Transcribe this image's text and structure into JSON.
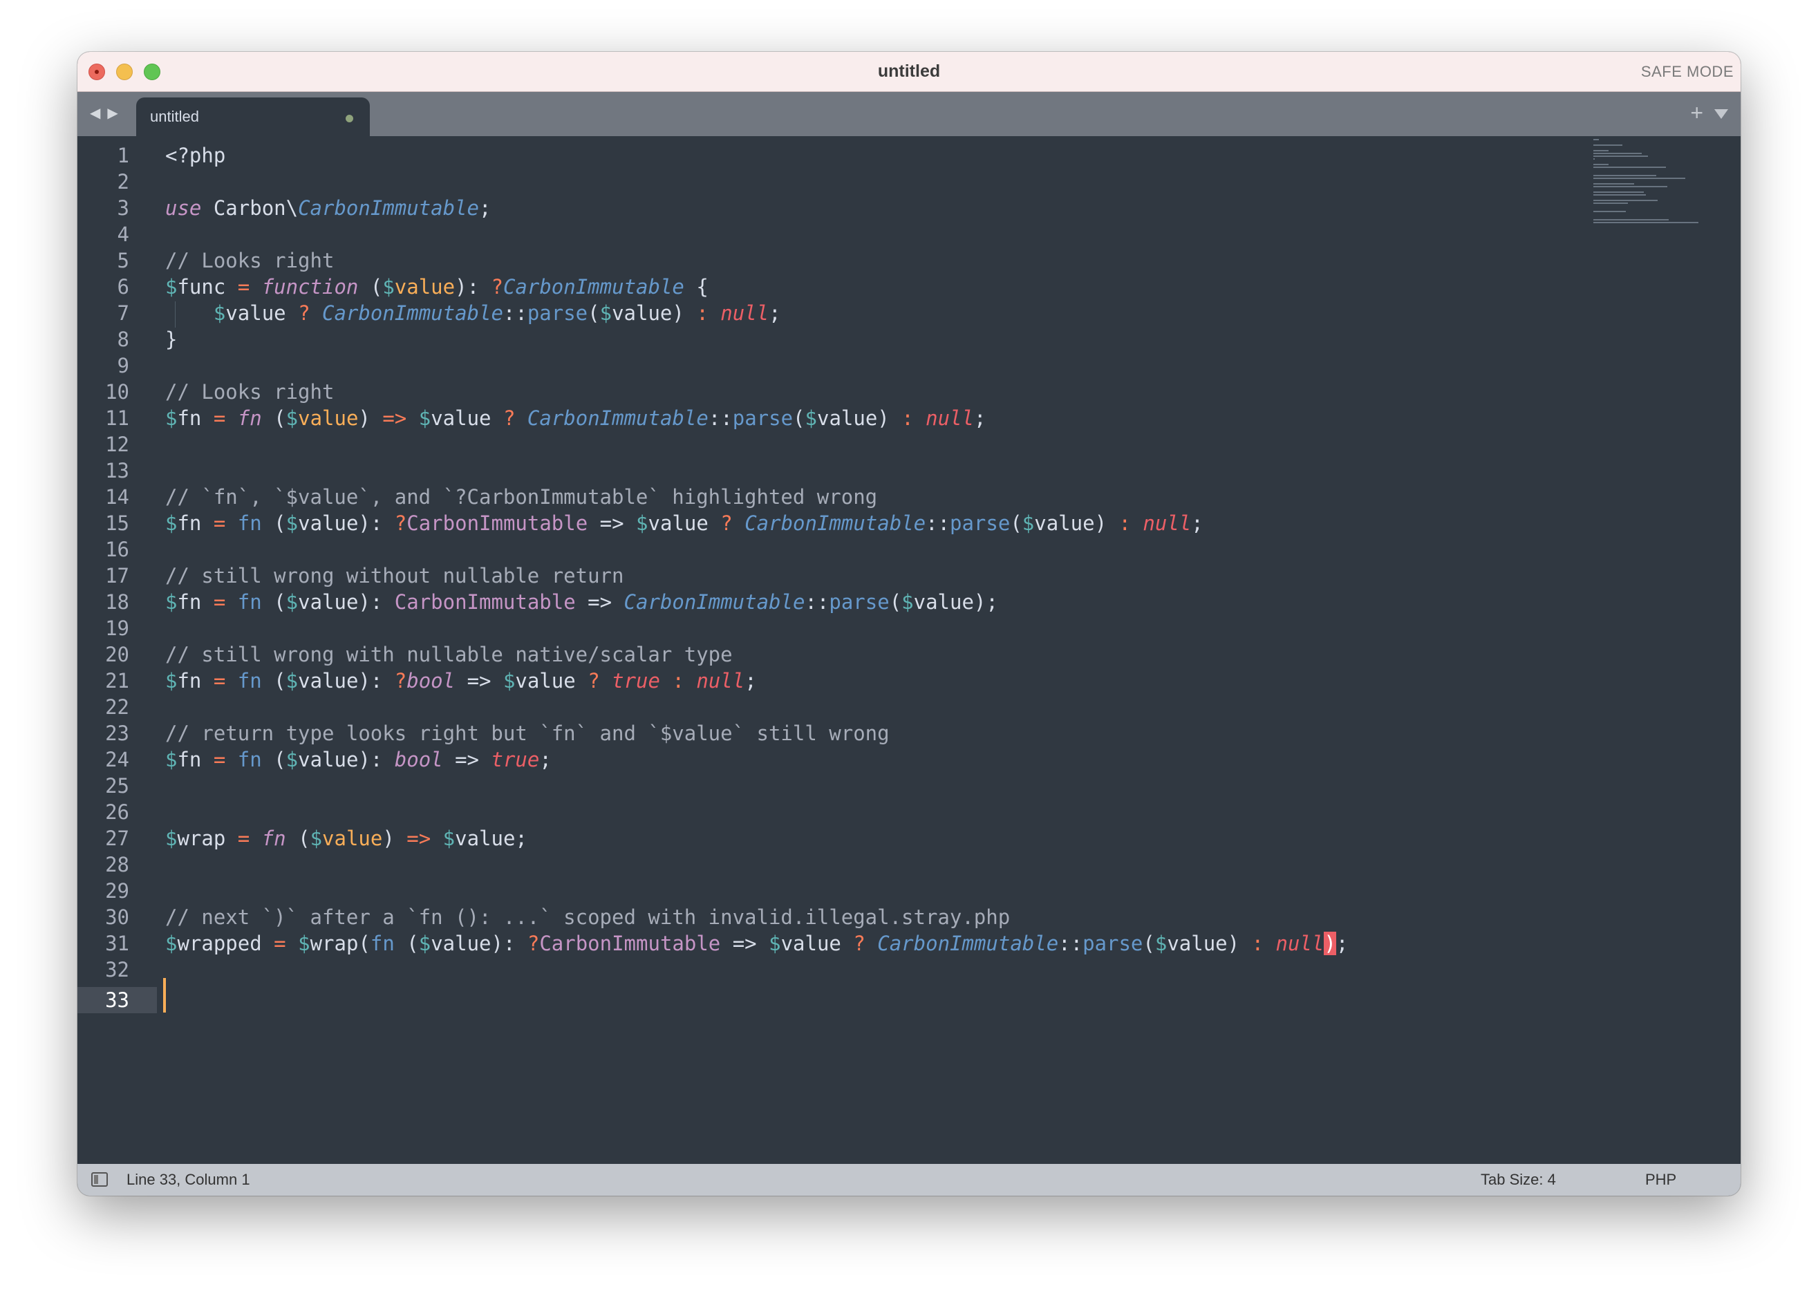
{
  "window": {
    "title": "untitled",
    "mode_label": "SAFE MODE"
  },
  "tabs": {
    "active_label": "untitled"
  },
  "editor": {
    "lines": [
      "1",
      "2",
      "3",
      "4",
      "5",
      "6",
      "7",
      "8",
      "9",
      "10",
      "11",
      "12",
      "13",
      "14",
      "15",
      "16",
      "17",
      "18",
      "19",
      "20",
      "21",
      "22",
      "23",
      "24",
      "25",
      "26",
      "27",
      "28",
      "29",
      "30",
      "31",
      "32",
      "33"
    ],
    "current_line": 33,
    "code": [
      [
        [
          "pp",
          "<?php"
        ]
      ],
      [],
      [
        [
          "kw",
          "use"
        ],
        [
          "pl",
          " Carbon\\"
        ],
        [
          "cl",
          "CarbonImmutable"
        ],
        [
          "pl",
          ";"
        ]
      ],
      [],
      [
        [
          "cm",
          "// Looks right"
        ]
      ],
      [
        [
          "vr",
          "$"
        ],
        [
          "pl",
          "func "
        ],
        [
          "op",
          "="
        ],
        [
          "pl",
          " "
        ],
        [
          "kw",
          "function"
        ],
        [
          "pl",
          " ("
        ],
        [
          "vr",
          "$"
        ],
        [
          "pa",
          "value"
        ],
        [
          "pl",
          "): "
        ],
        [
          "op",
          "?"
        ],
        [
          "cl",
          "CarbonImmutable"
        ],
        [
          "pl",
          " {"
        ]
      ],
      [
        [
          "pl",
          "    "
        ],
        [
          "vr",
          "$"
        ],
        [
          "pl",
          "value "
        ],
        [
          "op",
          "?"
        ],
        [
          "pl",
          " "
        ],
        [
          "cl",
          "CarbonImmutable"
        ],
        [
          "pl",
          "::"
        ],
        [
          "fn",
          "parse"
        ],
        [
          "pl",
          "("
        ],
        [
          "vr",
          "$"
        ],
        [
          "pl",
          "value) "
        ],
        [
          "op",
          ":"
        ],
        [
          "pl",
          " "
        ],
        [
          "cn",
          "null"
        ],
        [
          "pl",
          ";"
        ]
      ],
      [
        [
          "pl",
          "}"
        ]
      ],
      [],
      [
        [
          "cm",
          "// Looks right"
        ]
      ],
      [
        [
          "vr",
          "$"
        ],
        [
          "pl",
          "fn "
        ],
        [
          "op",
          "="
        ],
        [
          "pl",
          " "
        ],
        [
          "kw",
          "fn"
        ],
        [
          "pl",
          " ("
        ],
        [
          "vr",
          "$"
        ],
        [
          "pa",
          "value"
        ],
        [
          "pl",
          ") "
        ],
        [
          "op",
          "=>"
        ],
        [
          "pl",
          " "
        ],
        [
          "vr",
          "$"
        ],
        [
          "pl",
          "value "
        ],
        [
          "op",
          "?"
        ],
        [
          "pl",
          " "
        ],
        [
          "cl",
          "CarbonImmutable"
        ],
        [
          "pl",
          "::"
        ],
        [
          "fn",
          "parse"
        ],
        [
          "pl",
          "("
        ],
        [
          "vr",
          "$"
        ],
        [
          "pl",
          "value) "
        ],
        [
          "op",
          ":"
        ],
        [
          "pl",
          " "
        ],
        [
          "cn",
          "null"
        ],
        [
          "pl",
          ";"
        ]
      ],
      [],
      [],
      [
        [
          "cm",
          "// `fn`, `$value`, and `?CarbonImmutable` highlighted wrong"
        ]
      ],
      [
        [
          "vr",
          "$"
        ],
        [
          "pl",
          "fn "
        ],
        [
          "op",
          "="
        ],
        [
          "pl",
          " "
        ],
        [
          "fn",
          "fn"
        ],
        [
          "pl",
          " ("
        ],
        [
          "vr",
          "$"
        ],
        [
          "pl",
          "value): "
        ],
        [
          "op",
          "?"
        ],
        [
          "cb",
          "CarbonImmutable"
        ],
        [
          "pl",
          " => "
        ],
        [
          "vr",
          "$"
        ],
        [
          "pl",
          "value "
        ],
        [
          "op",
          "?"
        ],
        [
          "pl",
          " "
        ],
        [
          "cl",
          "CarbonImmutable"
        ],
        [
          "pl",
          "::"
        ],
        [
          "fn",
          "parse"
        ],
        [
          "pl",
          "("
        ],
        [
          "vr",
          "$"
        ],
        [
          "pl",
          "value) "
        ],
        [
          "op",
          ":"
        ],
        [
          "pl",
          " "
        ],
        [
          "cn",
          "null"
        ],
        [
          "pl",
          ";"
        ]
      ],
      [],
      [
        [
          "cm",
          "// still wrong without nullable return"
        ]
      ],
      [
        [
          "vr",
          "$"
        ],
        [
          "pl",
          "fn "
        ],
        [
          "op",
          "="
        ],
        [
          "pl",
          " "
        ],
        [
          "fn",
          "fn"
        ],
        [
          "pl",
          " ("
        ],
        [
          "vr",
          "$"
        ],
        [
          "pl",
          "value): "
        ],
        [
          "cb",
          "CarbonImmutable"
        ],
        [
          "pl",
          " => "
        ],
        [
          "cl",
          "CarbonImmutable"
        ],
        [
          "pl",
          "::"
        ],
        [
          "fn",
          "parse"
        ],
        [
          "pl",
          "("
        ],
        [
          "vr",
          "$"
        ],
        [
          "pl",
          "value);"
        ]
      ],
      [],
      [
        [
          "cm",
          "// still wrong with nullable native/scalar type"
        ]
      ],
      [
        [
          "vr",
          "$"
        ],
        [
          "pl",
          "fn "
        ],
        [
          "op",
          "="
        ],
        [
          "pl",
          " "
        ],
        [
          "fn",
          "fn"
        ],
        [
          "pl",
          " ("
        ],
        [
          "vr",
          "$"
        ],
        [
          "pl",
          "value): "
        ],
        [
          "op",
          "?"
        ],
        [
          "tp",
          "bool"
        ],
        [
          "pl",
          " => "
        ],
        [
          "vr",
          "$"
        ],
        [
          "pl",
          "value "
        ],
        [
          "op",
          "?"
        ],
        [
          "pl",
          " "
        ],
        [
          "cn",
          "true"
        ],
        [
          "pl",
          " "
        ],
        [
          "op",
          ":"
        ],
        [
          "pl",
          " "
        ],
        [
          "cn",
          "null"
        ],
        [
          "pl",
          ";"
        ]
      ],
      [],
      [
        [
          "cm",
          "// return type looks right but `fn` and `$value` still wrong"
        ]
      ],
      [
        [
          "vr",
          "$"
        ],
        [
          "pl",
          "fn "
        ],
        [
          "op",
          "="
        ],
        [
          "pl",
          " "
        ],
        [
          "fn",
          "fn"
        ],
        [
          "pl",
          " ("
        ],
        [
          "vr",
          "$"
        ],
        [
          "pl",
          "value): "
        ],
        [
          "tp",
          "bool"
        ],
        [
          "pl",
          " => "
        ],
        [
          "cn",
          "true"
        ],
        [
          "pl",
          ";"
        ]
      ],
      [],
      [],
      [
        [
          "vr",
          "$"
        ],
        [
          "pl",
          "wrap "
        ],
        [
          "op",
          "="
        ],
        [
          "pl",
          " "
        ],
        [
          "kw",
          "fn"
        ],
        [
          "pl",
          " ("
        ],
        [
          "vr",
          "$"
        ],
        [
          "pa",
          "value"
        ],
        [
          "pl",
          ") "
        ],
        [
          "op",
          "=>"
        ],
        [
          "pl",
          " "
        ],
        [
          "vr",
          "$"
        ],
        [
          "pl",
          "value;"
        ]
      ],
      [],
      [],
      [
        [
          "cm",
          "// next `)` after a `fn (): ...` scoped with invalid.illegal.stray.php"
        ]
      ],
      [
        [
          "vr",
          "$"
        ],
        [
          "pl",
          "wrapped "
        ],
        [
          "op",
          "="
        ],
        [
          "pl",
          " "
        ],
        [
          "vr",
          "$"
        ],
        [
          "pl",
          "wrap("
        ],
        [
          "fn",
          "fn"
        ],
        [
          "pl",
          " ("
        ],
        [
          "vr",
          "$"
        ],
        [
          "pl",
          "value): "
        ],
        [
          "op",
          "?"
        ],
        [
          "cb",
          "CarbonImmutable"
        ],
        [
          "pl",
          " => "
        ],
        [
          "vr",
          "$"
        ],
        [
          "pl",
          "value "
        ],
        [
          "op",
          "?"
        ],
        [
          "pl",
          " "
        ],
        [
          "cl",
          "CarbonImmutable"
        ],
        [
          "pl",
          "::"
        ],
        [
          "fn",
          "parse"
        ],
        [
          "pl",
          "("
        ],
        [
          "vr",
          "$"
        ],
        [
          "pl",
          "value) "
        ],
        [
          "op",
          ":"
        ],
        [
          "pl",
          " "
        ],
        [
          "cn",
          "null"
        ],
        [
          "ill",
          ")"
        ],
        [
          "pl",
          ";"
        ]
      ],
      [],
      []
    ]
  },
  "statusbar": {
    "position": "Line 33, Column 1",
    "tab_size": "Tab Size: 4",
    "syntax": "PHP"
  },
  "colors": {
    "background": "#303841",
    "comment": "#a6acb8",
    "keyword": "#c695c6",
    "class": "#6699cc",
    "operator": "#f97b58",
    "variable": "#5fb4b4",
    "parameter": "#f9ae58",
    "constant": "#ec5f66",
    "caret": "#f9ae58"
  },
  "icons": {
    "nav_back": "chevron-left-icon",
    "nav_forward": "chevron-right-icon",
    "new_tab": "plus-icon",
    "tab_menu": "triangle-down-icon",
    "sidebar_toggle": "sidebar-icon"
  }
}
